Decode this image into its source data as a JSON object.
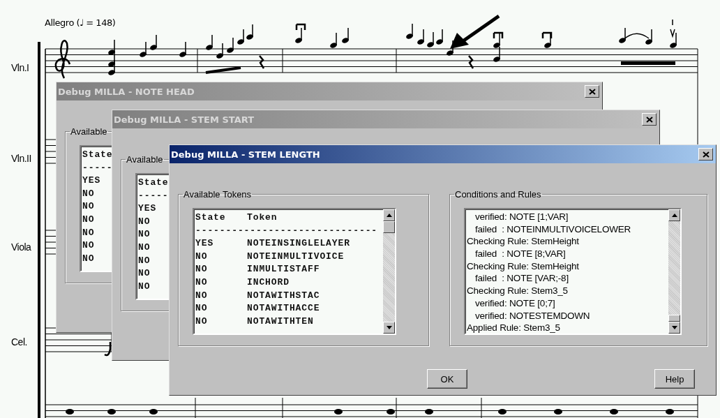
{
  "score": {
    "tempo": "Allegro (♩ = 148)",
    "instruments": [
      "Vln.I",
      "Vln.II",
      "Viola",
      "Cel."
    ]
  },
  "windows": [
    {
      "title": "Debug MILLA - NOTE HEAD",
      "active": false,
      "tokens": {
        "label": "Available",
        "header": {
          "state": "State"
        },
        "separator": "-----",
        "rows": [
          {
            "state": "YES"
          },
          {
            "state": "NO"
          },
          {
            "state": "NO"
          },
          {
            "state": "NO"
          },
          {
            "state": "NO"
          },
          {
            "state": "NO"
          },
          {
            "state": "NO"
          }
        ]
      }
    },
    {
      "title": "Debug MILLA - STEM START",
      "active": false,
      "tokens": {
        "label": "Available",
        "header": {
          "state": "State"
        },
        "separator": "-----",
        "rows": [
          {
            "state": "YES"
          },
          {
            "state": "NO"
          },
          {
            "state": "NO"
          },
          {
            "state": "NO"
          },
          {
            "state": "NO"
          },
          {
            "state": "NO"
          },
          {
            "state": "NO"
          }
        ]
      }
    },
    {
      "title": "Debug MILLA - STEM LENGTH",
      "active": true,
      "tokens": {
        "label": "Available Tokens",
        "header": {
          "state": "State",
          "token": "Token"
        },
        "separator": "------------------------------",
        "rows": [
          {
            "state": "YES",
            "token": "NOTEINSINGLELAYER"
          },
          {
            "state": "NO",
            "token": "NOTEINMULTIVOICE"
          },
          {
            "state": "NO",
            "token": "INMULTISTAFF"
          },
          {
            "state": "NO",
            "token": "INCHORD"
          },
          {
            "state": "NO",
            "token": "NOTAWITHSTAC"
          },
          {
            "state": "NO",
            "token": "NOTAWITHACCE"
          },
          {
            "state": "NO",
            "token": "NOTAWITHTEN"
          }
        ]
      },
      "conditions": {
        "label": "Conditions and Rules",
        "lines": [
          {
            "kind": "check",
            "text": "verified: NOTE [1;VAR]"
          },
          {
            "kind": "check",
            "text": "failed  : NOTEINMULTIVOICELOWER"
          },
          {
            "kind": "rule",
            "text": "Checking Rule: StemHeight"
          },
          {
            "kind": "check",
            "text": "failed  : NOTE [8;VAR]"
          },
          {
            "kind": "rule",
            "text": "Checking Rule: StemHeight"
          },
          {
            "kind": "check",
            "text": "failed  : NOTE [VAR;-8]"
          },
          {
            "kind": "rule",
            "text": "Checking Rule: Stem3_5"
          },
          {
            "kind": "check",
            "text": "verified: NOTE [0;7]"
          },
          {
            "kind": "check",
            "text": "verified: NOTESTEMDOWN"
          },
          {
            "kind": "rule",
            "text": "Applied Rule: Stem3_5"
          }
        ]
      },
      "buttons": [
        "OK",
        "Help"
      ]
    }
  ]
}
